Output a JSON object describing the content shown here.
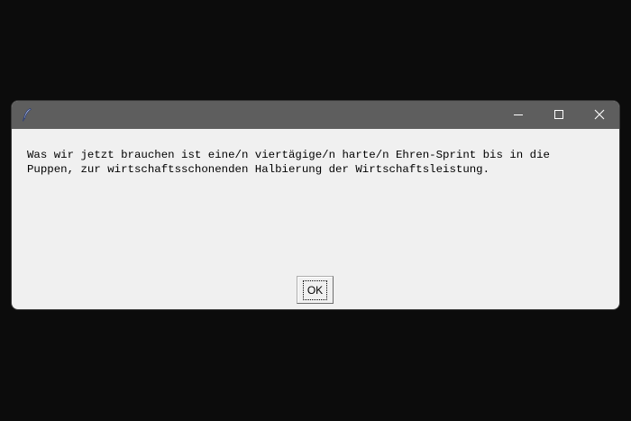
{
  "window": {
    "icon": "feather-icon",
    "controls": {
      "minimize": "minimize-icon",
      "maximize": "maximize-icon",
      "close": "close-icon"
    }
  },
  "dialog": {
    "message_line1": "Was wir jetzt brauchen ist eine/n viertägige/n harte/n Ehren-Sprint bis in die",
    "message_line2": "Puppen, zur wirtschaftsschonenden Halbierung der Wirtschaftsleistung.",
    "ok_label": "OK"
  },
  "colors": {
    "titlebar": "#5e5e5e",
    "body": "#f0f0f0",
    "desktop": "#0c0c0c"
  }
}
